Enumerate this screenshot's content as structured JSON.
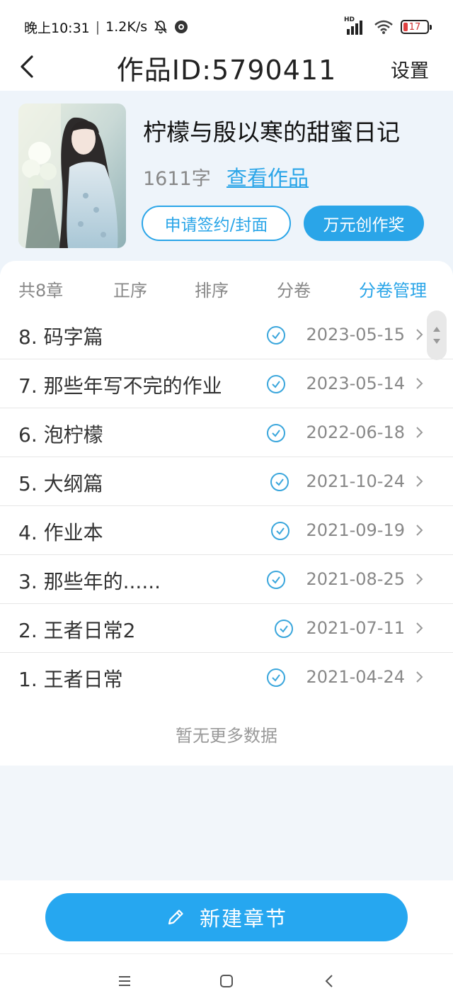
{
  "status_bar": {
    "time": "晚上10:31",
    "speed": "1.2K/s",
    "battery": "17",
    "hd_label": "HD"
  },
  "header": {
    "title": "作品ID:5790411",
    "settings_label": "设置"
  },
  "book": {
    "title": "柠檬与殷以寒的甜蜜日记",
    "word_count": "1611字",
    "view_link": "查看作品",
    "sign_button": "申请签约/封面",
    "award_button": "万元创作奖"
  },
  "tabs": [
    {
      "label": "共8章"
    },
    {
      "label": "正序"
    },
    {
      "label": "排序"
    },
    {
      "label": "分卷"
    },
    {
      "label": "分卷管理"
    }
  ],
  "chapters": [
    {
      "title": "8. 码字篇",
      "date": "2023-05-15"
    },
    {
      "title": "7. 那些年写不完的作业",
      "date": "2023-05-14"
    },
    {
      "title": "6. 泡柠檬",
      "date": "2022-06-18"
    },
    {
      "title": "5. 大纲篇",
      "date": "2021-10-24"
    },
    {
      "title": "4. 作业本",
      "date": "2021-09-19"
    },
    {
      "title": "3. 那些年的......",
      "date": "2021-08-25"
    },
    {
      "title": "2. 王者日常2",
      "date": "2021-07-11"
    },
    {
      "title": "1. 王者日常",
      "date": "2021-04-24"
    }
  ],
  "no_more_text": "暂无更多数据",
  "new_chapter_button": "新建章节",
  "colors": {
    "accent": "#2aa5e8",
    "header_bg": "#eef4fa"
  }
}
